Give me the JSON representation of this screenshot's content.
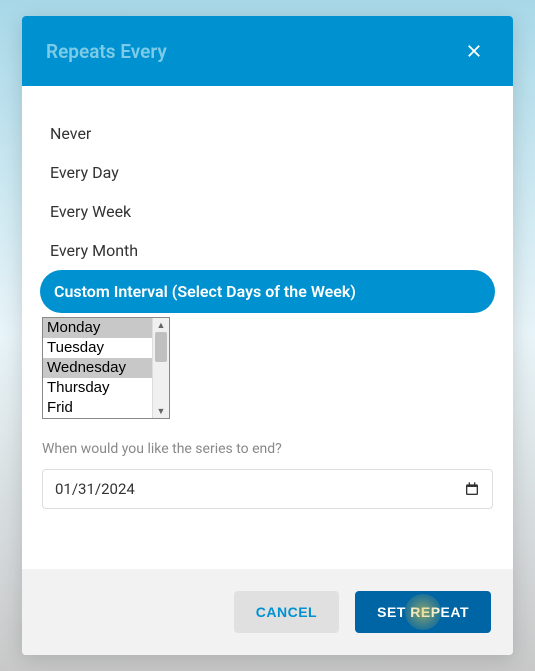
{
  "modal": {
    "title": "Repeats Every",
    "options": [
      {
        "label": "Never"
      },
      {
        "label": "Every Day"
      },
      {
        "label": "Every Week"
      },
      {
        "label": "Every Month"
      },
      {
        "label": "Custom Interval (Select Days of the Week)"
      }
    ],
    "days": [
      {
        "label": "Monday",
        "selected": true
      },
      {
        "label": "Tuesday",
        "selected": false
      },
      {
        "label": "Wednesday",
        "selected": true
      },
      {
        "label": "Thursday",
        "selected": false
      },
      {
        "label": "Frid",
        "selected": false
      }
    ],
    "series_end_label": "When would you like the series to end?",
    "date_value": "01/31/2024",
    "cancel_label": "CANCEL",
    "submit_label": "SET REPEAT"
  }
}
